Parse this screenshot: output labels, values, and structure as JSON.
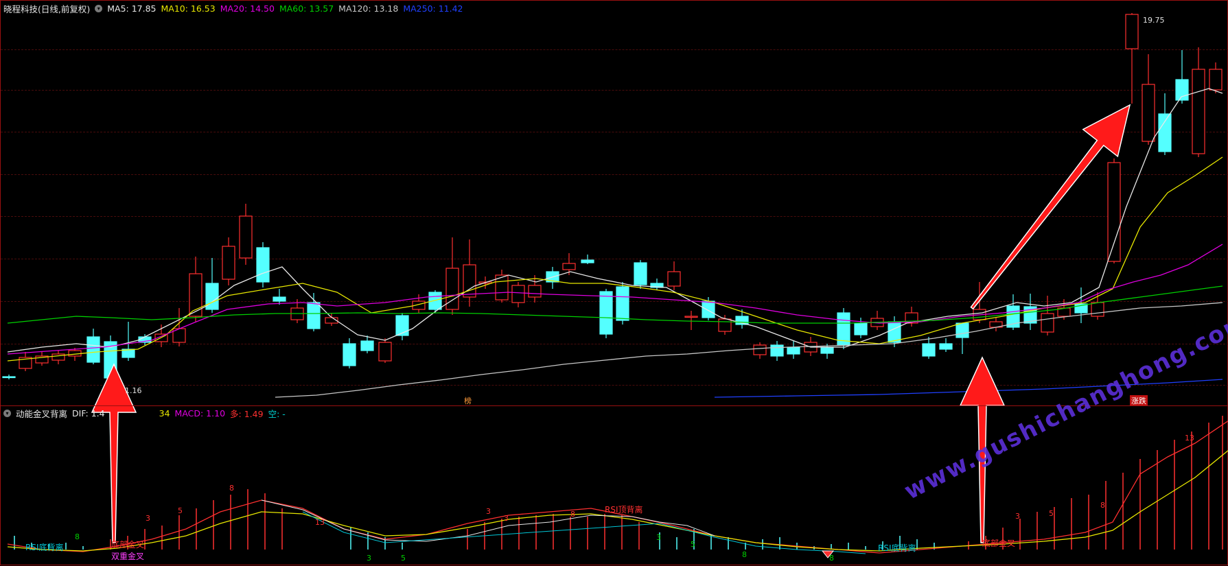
{
  "header": {
    "title": "晓程科技(日线,前复权)",
    "ma": [
      {
        "label": "MA5: 17.85",
        "color": "#e8e8e8"
      },
      {
        "label": "MA10: 16.53",
        "color": "#e8e800"
      },
      {
        "label": "MA20: 14.50",
        "color": "#e000e0"
      },
      {
        "label": "MA60: 13.57",
        "color": "#00d000"
      },
      {
        "label": "MA120: 13.18",
        "color": "#c8c8c8"
      },
      {
        "label": "MA250: 11.42",
        "color": "#2040ff"
      }
    ]
  },
  "indicator": {
    "title": "动能金叉背离",
    "items": [
      {
        "label": "DIF: 1.4",
        "color": "#e8e8e8"
      },
      {
        "label": "34",
        "color": "#e8e800"
      },
      {
        "label": "MACD: 1.10",
        "color": "#e000e0"
      },
      {
        "label": "多: 1.49",
        "color": "#ff3030"
      },
      {
        "label": "空: -",
        "color": "#00d0d0"
      }
    ]
  },
  "price_labels": {
    "high": "19.75",
    "low": "1.16"
  },
  "markers": {
    "bang": "榜",
    "zhangdie": "涨跌"
  },
  "annotations": [
    {
      "text": "RSI底背离",
      "color": "#00c8d8"
    },
    {
      "text": "底部金叉",
      "color": "#ff3030"
    },
    {
      "text": "双重金叉",
      "color": "#ff40ff"
    },
    {
      "text": "RSI顶背离",
      "color": "#ff3030"
    },
    {
      "text": "RSI底背离",
      "color": "#00c8d8"
    },
    {
      "text": "底部金叉",
      "color": "#ff3030"
    }
  ],
  "counts": [
    "8",
    "3",
    "5",
    "8",
    "13",
    "3",
    "3",
    "5",
    "3",
    "8",
    "8",
    "3",
    "5",
    "8",
    "13",
    "3",
    "5",
    "8",
    "13"
  ],
  "watermark": "www.gushichanghong.com",
  "colors": {
    "up": "#ff3030",
    "down": "#54ffff",
    "border": "#9a1010",
    "arrow": "#ff1a1a"
  }
}
